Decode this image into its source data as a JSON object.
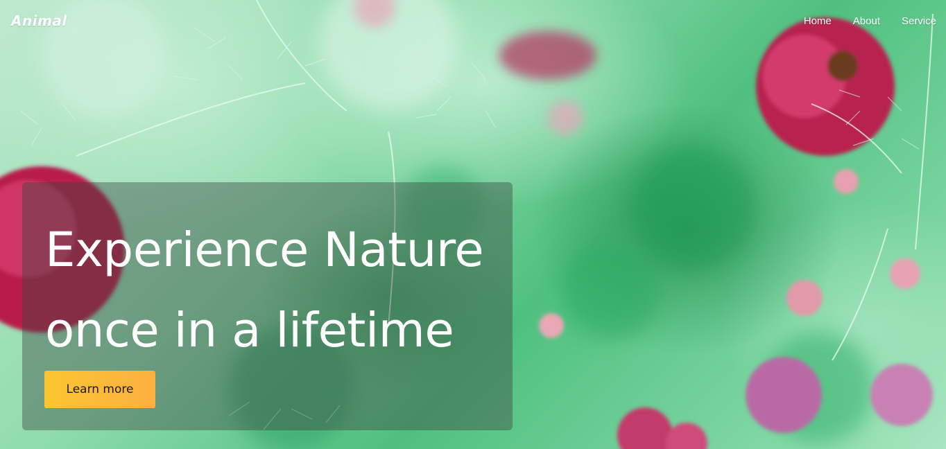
{
  "brand": {
    "logo_text": "Animal"
  },
  "nav": {
    "items": [
      {
        "label": "Home"
      },
      {
        "label": "About"
      },
      {
        "label": "Service"
      }
    ]
  },
  "hero": {
    "title_line1": "Experience Nature",
    "title_line2": "once in a lifetime",
    "cta_label": "Learn more"
  },
  "colors": {
    "cta_background": "#fbc531",
    "card_overlay": "rgba(60,70,65,0.42)",
    "nav_text": "#ffffff"
  }
}
